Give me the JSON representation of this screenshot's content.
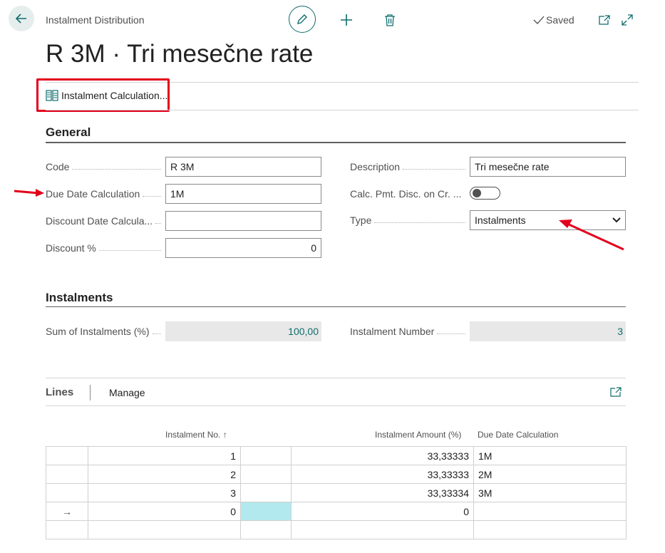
{
  "header": {
    "caption": "Instalment Distribution",
    "status": "Saved",
    "title": "R 3M · Tri mesečne rate"
  },
  "actions": {
    "instalment_calculation": "Instalment Calculation..."
  },
  "general": {
    "title": "General",
    "code": {
      "label": "Code",
      "value": "R 3M"
    },
    "due_date_calculation": {
      "label": "Due Date Calculation",
      "value": "1M"
    },
    "discount_date_calculation": {
      "label": "Discount Date Calcula...",
      "value": ""
    },
    "discount_pct": {
      "label": "Discount %",
      "value": "0"
    },
    "description": {
      "label": "Description",
      "value": "Tri mesečne rate"
    },
    "calc_pmt_disc": {
      "label": "Calc. Pmt. Disc. on Cr. ...",
      "value": false
    },
    "type": {
      "label": "Type",
      "value": "Instalments"
    }
  },
  "instalments": {
    "title": "Instalments",
    "sum": {
      "label": "Sum of Instalments (%)",
      "value": "100,00"
    },
    "number": {
      "label": "Instalment Number",
      "value": "3"
    }
  },
  "lines": {
    "tab_label": "Lines",
    "manage_label": "Manage",
    "columns": {
      "instalment_no": "Instalment No. ↑",
      "instalment_amount": "Instalment Amount (%)",
      "due_date_calc": "Due Date Calculation"
    },
    "rows": [
      {
        "marker": "",
        "no": "1",
        "amount": "33,33333",
        "due": "1M"
      },
      {
        "marker": "",
        "no": "2",
        "amount": "33,33333",
        "due": "2M"
      },
      {
        "marker": "",
        "no": "3",
        "amount": "33,33334",
        "due": "3M"
      },
      {
        "marker": "→",
        "no": "0",
        "amount": "0",
        "due": ""
      },
      {
        "marker": "",
        "no": "",
        "amount": "",
        "due": ""
      }
    ]
  },
  "colors": {
    "accent": "#0f6d6d",
    "annotation_red": "#e3001b",
    "selected_cell": "#b2e9ee"
  },
  "icons": [
    "back-arrow-icon",
    "pencil-icon",
    "plus-icon",
    "trash-icon",
    "checkmark-icon",
    "open-new-window-icon",
    "expand-icon",
    "calculation-icon",
    "chevron-down-icon",
    "expand-part-icon"
  ]
}
